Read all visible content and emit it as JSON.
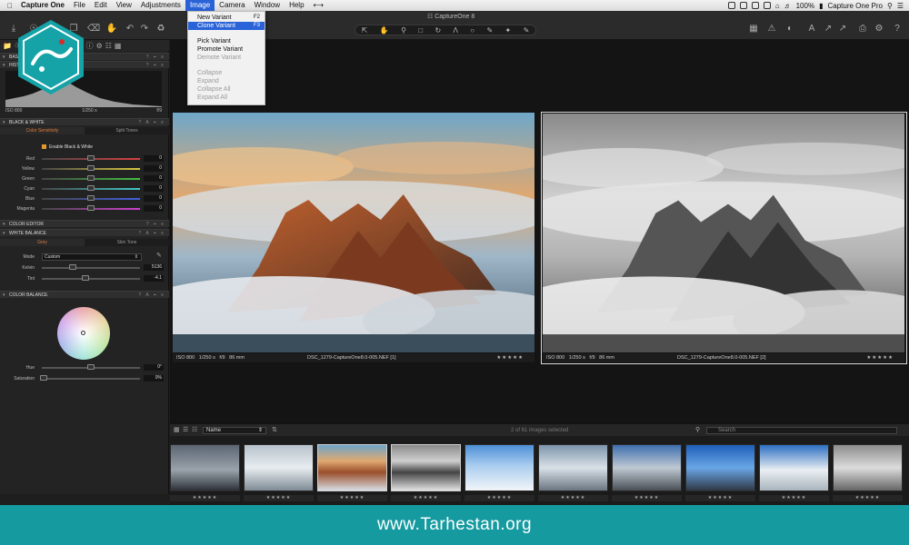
{
  "menubar": {
    "app_name": "Capture One",
    "items": [
      "File",
      "Edit",
      "View",
      "Adjustments",
      "Image",
      "Camera",
      "Window",
      "Help"
    ],
    "active_index": 4,
    "zoom": "100%",
    "right_app": "Capture One Pro"
  },
  "window_title": "CaptureOne 8",
  "image_menu": {
    "items": [
      {
        "label": "New Variant",
        "shortcut": "F2",
        "state": "normal"
      },
      {
        "label": "Clone Variant",
        "shortcut": "F3",
        "state": "highlight"
      },
      {
        "label": "Pick Variant",
        "shortcut": "",
        "state": "normal"
      },
      {
        "label": "Promote Variant",
        "shortcut": "",
        "state": "normal"
      },
      {
        "label": "Demote Variant",
        "shortcut": "",
        "state": "disabled"
      },
      {
        "label": "Collapse",
        "shortcut": "",
        "state": "disabled"
      },
      {
        "label": "Expand",
        "shortcut": "",
        "state": "disabled"
      },
      {
        "label": "Collapse All",
        "shortcut": "",
        "state": "disabled"
      },
      {
        "label": "Expand All",
        "shortcut": "",
        "state": "disabled"
      }
    ]
  },
  "panel": {
    "base_characteristics": "BASE CHARA",
    "histogram": {
      "header": "HISTOGR",
      "iso": "ISO 800",
      "shutter": "1/250 s",
      "aperture": "f/9"
    },
    "black_white": {
      "header": "BLACK & WHITE",
      "tabs": [
        "Color Sensitivity",
        "Split Tones"
      ],
      "enable_label": "Enable Black & White",
      "sliders": [
        {
          "label": "Red",
          "value": "0",
          "color": "#d94040"
        },
        {
          "label": "Yellow",
          "value": "0",
          "color": "#d9c640"
        },
        {
          "label": "Green",
          "value": "0",
          "color": "#40c040"
        },
        {
          "label": "Cyan",
          "value": "0",
          "color": "#40c8c8"
        },
        {
          "label": "Blue",
          "value": "0",
          "color": "#4060e0"
        },
        {
          "label": "Magenta",
          "value": "0",
          "color": "#d040d0"
        }
      ]
    },
    "color_editor": "COLOR EDITOR",
    "white_balance": {
      "header": "WHITE BALANCE",
      "tabs": [
        "Grey",
        "Skin Tone"
      ],
      "mode_label": "Mode",
      "mode_value": "Custom",
      "kelvin_label": "Kelvin",
      "kelvin_value": "5136",
      "tint_label": "Tint",
      "tint_value": "-4.1"
    },
    "color_balance": {
      "header": "COLOR BALANCE",
      "hue_label": "Hue",
      "hue_value": "0°",
      "saturation_label": "Saturation",
      "saturation_value": "0%"
    }
  },
  "viewer": {
    "left": {
      "iso": "ISO 800",
      "shutter": "1/250 s",
      "aperture": "f/9",
      "focal": "86 mm",
      "filename": "DSC_1279-CaptureOne8.0-005.NEF [1]"
    },
    "right": {
      "iso": "ISO 800",
      "shutter": "1/250 s",
      "aperture": "f/9",
      "focal": "86 mm",
      "filename": "DSC_1279-CaptureOne8.0-005.NEF [2]"
    },
    "stars": "★★★★★"
  },
  "filmstrip": {
    "sort_value": "Name",
    "count_text": "2 of 61 images selected",
    "search_placeholder": "Search",
    "stars": "★★★★★"
  },
  "banner": {
    "url": "www.Tarhestan.org"
  },
  "logo_text": "طرحستان"
}
